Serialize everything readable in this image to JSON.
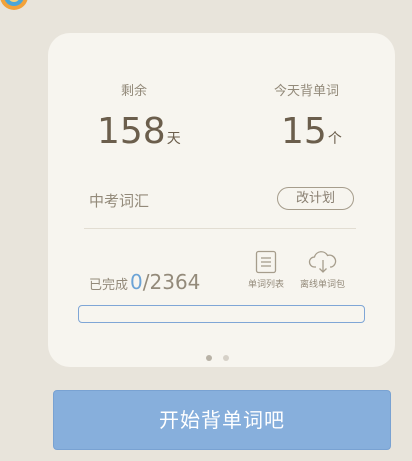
{
  "stats": {
    "remaining_label": "剩余",
    "remaining_value": "158",
    "remaining_unit": "天",
    "today_label": "今天背单词",
    "today_value": "15",
    "today_unit": "个"
  },
  "book": {
    "name": "中考词汇",
    "change_plan_label": "改计划"
  },
  "progress": {
    "prefix": "已完成",
    "done": "0",
    "separator": "/",
    "total": "2364",
    "fraction": 0
  },
  "tools": [
    {
      "label": "单词列表",
      "icon": "word-list-icon"
    },
    {
      "label": "离线单词包",
      "icon": "cloud-download-icon"
    }
  ],
  "pager": {
    "count": 2,
    "active": 0,
    "active_color": "#b8b2a6",
    "inactive_color": "#d6d1c8"
  },
  "start_button_label": "开始背单词吧",
  "colors": {
    "accent": "#87afdc",
    "text_brown": "#6b5e4c",
    "text_muted": "#938a7a",
    "done_blue": "#6ba3d6"
  }
}
